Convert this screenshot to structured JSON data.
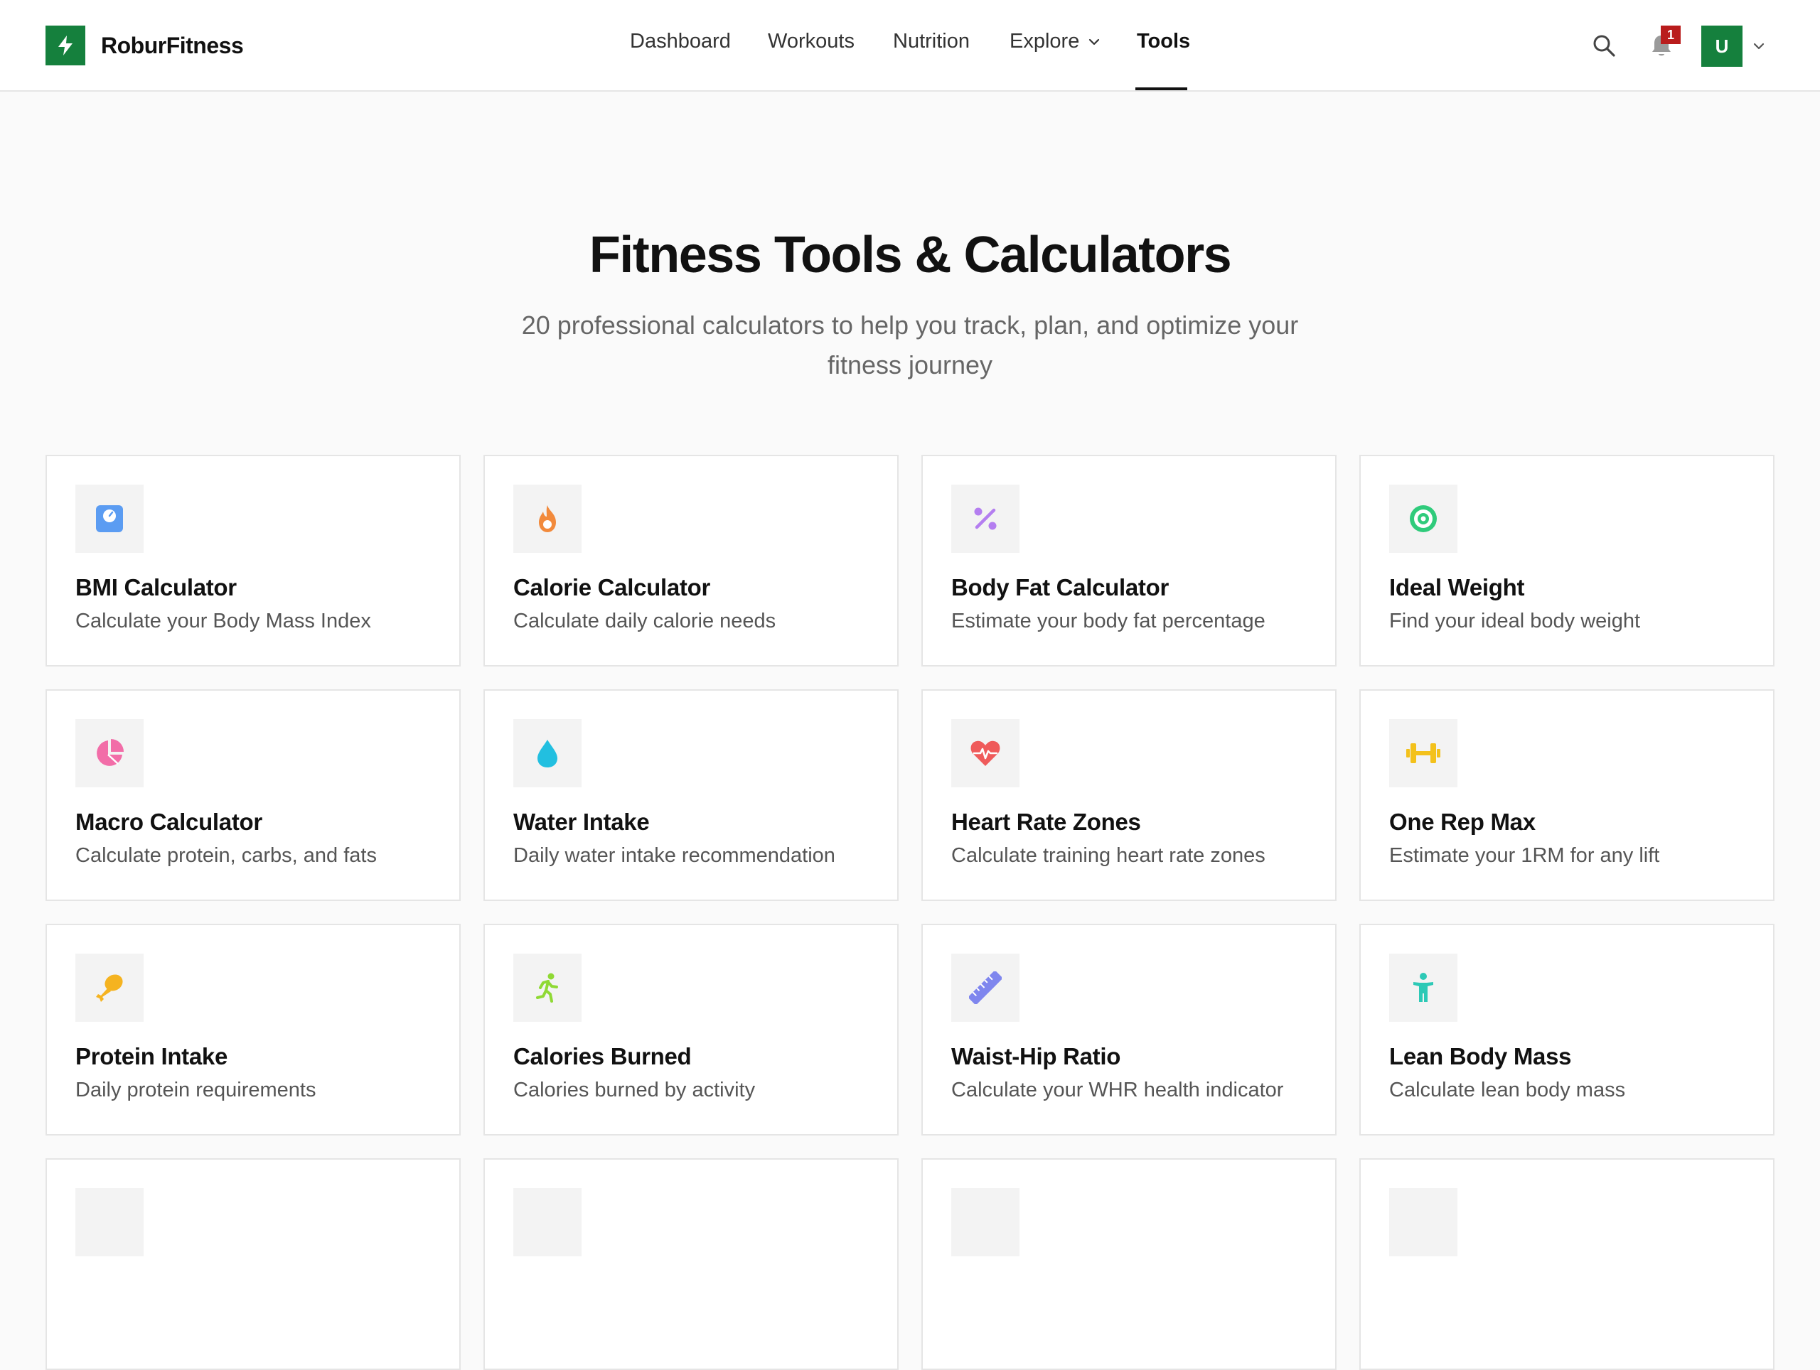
{
  "brand": {
    "name": "RoburFitness"
  },
  "nav": {
    "items": [
      {
        "label": "Dashboard"
      },
      {
        "label": "Workouts"
      },
      {
        "label": "Nutrition"
      },
      {
        "label": "Explore"
      },
      {
        "label": "Tools"
      }
    ],
    "active": "Tools"
  },
  "header": {
    "notifications_count": "1",
    "avatar_initial": "U"
  },
  "hero": {
    "title": "Fitness Tools & Calculators",
    "subtitle": "20 professional calculators to help you track, plan, and optimize your fitness journey"
  },
  "tools": [
    {
      "title": "BMI Calculator",
      "desc": "Calculate your Body Mass Index",
      "icon": "scale-icon",
      "color": "#5b9cf2"
    },
    {
      "title": "Calorie Calculator",
      "desc": "Calculate daily calorie needs",
      "icon": "flame-icon",
      "color": "#f28a3c"
    },
    {
      "title": "Body Fat Calculator",
      "desc": "Estimate your body fat percentage",
      "icon": "percent-icon",
      "color": "#b47ef0"
    },
    {
      "title": "Ideal Weight",
      "desc": "Find your ideal body weight",
      "icon": "target-icon",
      "color": "#2fcb7b"
    },
    {
      "title": "Macro Calculator",
      "desc": "Calculate protein, carbs, and fats",
      "icon": "pie-chart-icon",
      "color": "#f26da8"
    },
    {
      "title": "Water Intake",
      "desc": "Daily water intake recommendation",
      "icon": "droplet-icon",
      "color": "#22bfe0"
    },
    {
      "title": "Heart Rate Zones",
      "desc": "Calculate training heart rate zones",
      "icon": "heart-pulse-icon",
      "color": "#ef5b5b"
    },
    {
      "title": "One Rep Max",
      "desc": "Estimate your 1RM for any lift",
      "icon": "dumbbell-icon",
      "color": "#f3c11b"
    },
    {
      "title": "Protein Intake",
      "desc": "Daily protein requirements",
      "icon": "drumstick-icon",
      "color": "#f5b320"
    },
    {
      "title": "Calories Burned",
      "desc": "Calories burned by activity",
      "icon": "running-icon",
      "color": "#8fd934"
    },
    {
      "title": "Waist-Hip Ratio",
      "desc": "Calculate your WHR health indicator",
      "icon": "ruler-icon",
      "color": "#7f86ee"
    },
    {
      "title": "Lean Body Mass",
      "desc": "Calculate lean body mass",
      "icon": "person-icon",
      "color": "#2dc9b6"
    }
  ]
}
